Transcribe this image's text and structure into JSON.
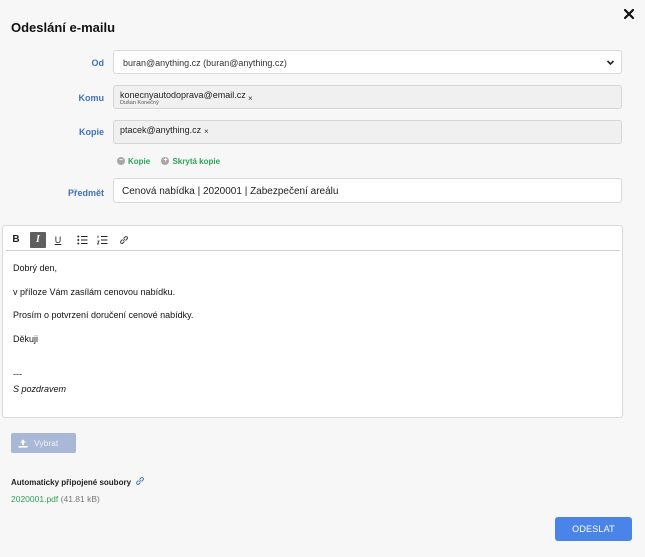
{
  "dialog": {
    "title": "Odeslání e-mailu"
  },
  "from": {
    "label": "Od",
    "value": "buran@anything.cz (buran@anything.cz)"
  },
  "to": {
    "label": "Komu",
    "tags": [
      {
        "email": "konecnyautodoprava@email.cz",
        "name": "Dušan Konečný",
        "remove": "×"
      }
    ]
  },
  "cc": {
    "label": "Kopie",
    "tags": [
      {
        "email": "ptacek@anything.cz",
        "remove": "×"
      }
    ]
  },
  "cc_links": {
    "remove_cc": "Kopie",
    "add_bcc": "Skrytá kopie"
  },
  "subject": {
    "label": "Předmět",
    "value": "Cenová nabídka | 2020001 |  Zabezpečení areálu"
  },
  "toolbar": {
    "bold": "B",
    "italic": "I",
    "underline": "U",
    "italic_active": true
  },
  "body": {
    "lines": [
      "Dobrý den,",
      "v příloze Vám zasílám cenovou nabídku.",
      "Prosím o potvrzení doručení cenové nabídky.",
      "Děkuji",
      "---",
      "S pozdravem"
    ]
  },
  "attachments": {
    "choose_label": "Vybrat",
    "auto_label": "Automaticky připojené soubory",
    "files": [
      {
        "name": "2020001.pdf",
        "size": "(41.81 kB)"
      }
    ]
  },
  "actions": {
    "send_label": "ODESLAT"
  },
  "colors": {
    "label_blue": "#3f73b7",
    "link_green": "#2fa15a",
    "send_blue": "#4a84e8"
  }
}
